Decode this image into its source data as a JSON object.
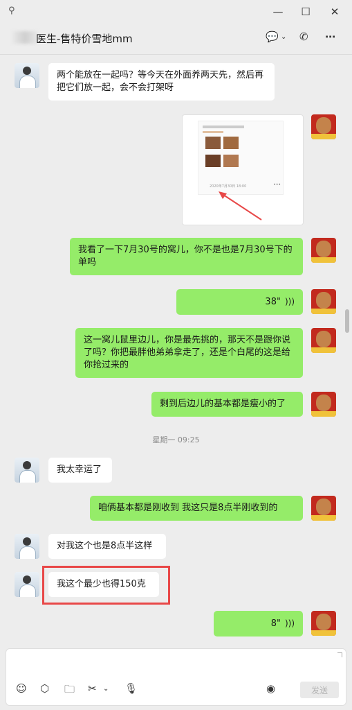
{
  "window": {
    "pin_icon": "pin-icon",
    "minimize_icon": "minimize-icon",
    "maximize_icon": "maximize-icon",
    "close_icon": "close-icon"
  },
  "header": {
    "title": "医生-售特价雪地mm",
    "icons": [
      "chat-bubble-icon",
      "chevron-down-icon",
      "call-icon",
      "more-icon"
    ]
  },
  "messages": [
    {
      "side": "in",
      "text": "两个能放在一起吗？等今天在外面养两天先，然后再把它们放一起，会不会打架呀"
    },
    {
      "side": "out",
      "type": "image"
    },
    {
      "side": "out",
      "text": "我看了一下7月30号的窝儿，你不是也是7月30号下的单吗"
    },
    {
      "side": "out",
      "type": "voice",
      "duration": "38\""
    },
    {
      "side": "out",
      "text": "这一窝儿鼠里边儿，你是最先挑的，那天不是跟你说了吗？你把最胖他弟弟拿走了，还是个白尾的这是给你抢过来的"
    },
    {
      "side": "out",
      "text": "剩到后边儿的基本都是瘦小的了"
    },
    {
      "side": "in",
      "text": "我太幸运了"
    },
    {
      "side": "out",
      "text": "咱俩基本都是刚收到    我这只是8点半刚收到的"
    },
    {
      "side": "in",
      "text": "对我这个也是8点半这样"
    },
    {
      "side": "in",
      "text": "我这个最少也得150克"
    },
    {
      "side": "out",
      "type": "voice",
      "duration": "8\""
    }
  ],
  "timestamp": "星期一 09:25",
  "image_preview": {
    "date_text": "2020年7月30日 18:00",
    "more": "•••"
  },
  "input": {
    "tools": [
      "emoji-icon",
      "cube-icon",
      "folder-icon",
      "scissors-icon",
      "chevron-down-icon",
      "microphone-icon",
      "voice-input-icon"
    ],
    "send_label": "发送"
  },
  "colors": {
    "out_bubble": "#95ec69",
    "in_bubble": "#ffffff",
    "background": "#ededed",
    "highlight": "#e84848"
  }
}
